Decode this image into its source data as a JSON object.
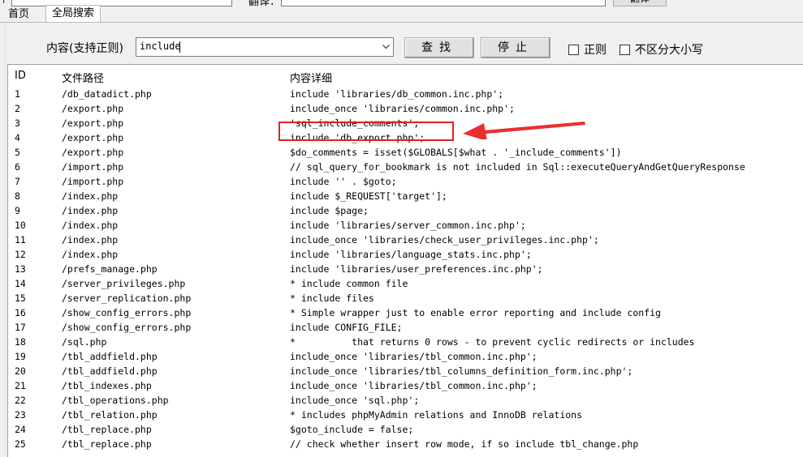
{
  "topbar": {
    "label_partial": "翻译：",
    "button_partial": "翻译"
  },
  "tabs": [
    {
      "label": "首页"
    },
    {
      "label": "全局搜索"
    }
  ],
  "search": {
    "label": "内容(支持正则)",
    "value": "include",
    "find_button": "查找",
    "stop_button": "停止",
    "regex_label": "正则",
    "case_label": "不区分大小写"
  },
  "columns": {
    "id": "ID",
    "path": "文件路径",
    "detail": "内容详细"
  },
  "rows": [
    {
      "id": "1",
      "path": "/db_datadict.php",
      "detail": "include 'libraries/db_common.inc.php';"
    },
    {
      "id": "2",
      "path": "/export.php",
      "detail": "include_once 'libraries/common.inc.php';"
    },
    {
      "id": "3",
      "path": "/export.php",
      "detail": "'sql_include_comments',"
    },
    {
      "id": "4",
      "path": "/export.php",
      "detail": "include 'db_export.php';"
    },
    {
      "id": "5",
      "path": "/export.php",
      "detail": "$do_comments = isset($GLOBALS[$what . '_include_comments'])"
    },
    {
      "id": "6",
      "path": "/import.php",
      "detail": "// sql_query_for_bookmark is not included in Sql::executeQueryAndGetQueryResponse"
    },
    {
      "id": "7",
      "path": "/import.php",
      "detail": "include '' . $goto;"
    },
    {
      "id": "8",
      "path": "/index.php",
      "detail": "include $_REQUEST['target'];"
    },
    {
      "id": "9",
      "path": "/index.php",
      "detail": "include $page;"
    },
    {
      "id": "10",
      "path": "/index.php",
      "detail": "include 'libraries/server_common.inc.php';"
    },
    {
      "id": "11",
      "path": "/index.php",
      "detail": "include_once 'libraries/check_user_privileges.inc.php';"
    },
    {
      "id": "12",
      "path": "/index.php",
      "detail": "include 'libraries/language_stats.inc.php';"
    },
    {
      "id": "13",
      "path": "/prefs_manage.php",
      "detail": "include 'libraries/user_preferences.inc.php';"
    },
    {
      "id": "14",
      "path": "/server_privileges.php",
      "detail": "* include common file"
    },
    {
      "id": "15",
      "path": "/server_replication.php",
      "detail": "* include files"
    },
    {
      "id": "16",
      "path": "/show_config_errors.php",
      "detail": "* Simple wrapper just to enable error reporting and include config"
    },
    {
      "id": "17",
      "path": "/show_config_errors.php",
      "detail": "include CONFIG_FILE;"
    },
    {
      "id": "18",
      "path": "/sql.php",
      "detail": "*          that returns 0 rows - to prevent cyclic redirects or includes"
    },
    {
      "id": "19",
      "path": "/tbl_addfield.php",
      "detail": "include_once 'libraries/tbl_common.inc.php';"
    },
    {
      "id": "20",
      "path": "/tbl_addfield.php",
      "detail": "include_once 'libraries/tbl_columns_definition_form.inc.php';"
    },
    {
      "id": "21",
      "path": "/tbl_indexes.php",
      "detail": "include_once 'libraries/tbl_common.inc.php';"
    },
    {
      "id": "22",
      "path": "/tbl_operations.php",
      "detail": "include_once 'sql.php';"
    },
    {
      "id": "23",
      "path": "/tbl_relation.php",
      "detail": "* includes phpMyAdmin relations and InnoDB relations"
    },
    {
      "id": "24",
      "path": "/tbl_replace.php",
      "detail": "$goto_include = false;"
    },
    {
      "id": "25",
      "path": "/tbl_replace.php",
      "detail": "// check whether insert row mode, if so include tbl_change.php"
    }
  ],
  "colors": {
    "highlight": "#e02020",
    "arrow": "#e83030"
  }
}
